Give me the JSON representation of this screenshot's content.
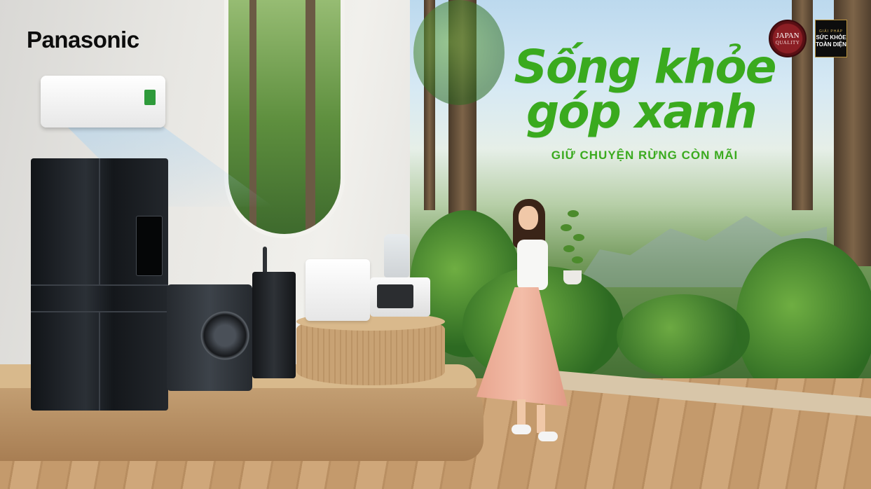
{
  "brand": {
    "name": "Panasonic"
  },
  "headline": {
    "line1": "Sống khỏe",
    "line2": "góp xanh"
  },
  "tagline": "GIỮ CHUYỆN RỪNG CÒN MÃI",
  "badges": {
    "japan_quality": {
      "main": "JAPAN",
      "sub": "QUALITY"
    },
    "health": {
      "small": "GIẢI PHÁP",
      "line1": "SỨC KHỎE",
      "line2": "TOÀN DIỆN"
    }
  },
  "colors": {
    "accent_green": "#3aaa1e",
    "brand_black": "#0d0d0d"
  }
}
